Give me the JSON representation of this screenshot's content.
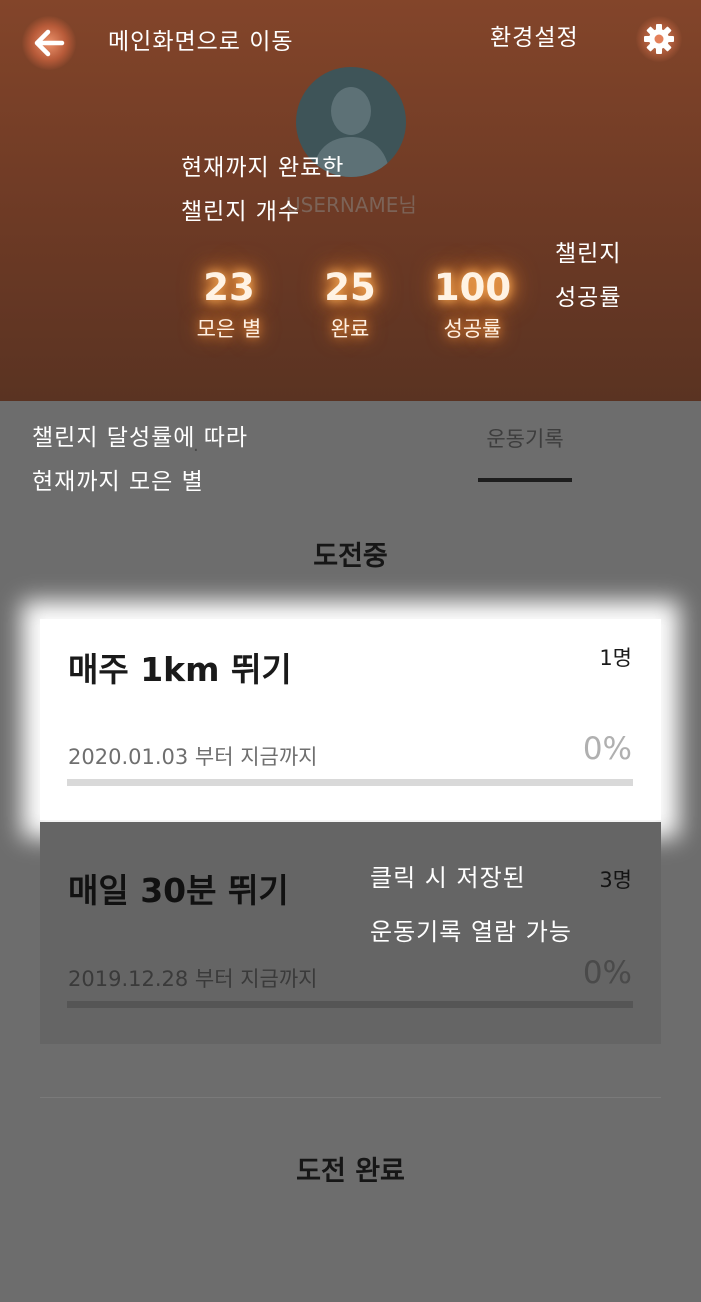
{
  "header": {
    "back_hint": "메인화면으로 이동",
    "settings_hint": "환경설정",
    "username": "USERNAME님",
    "completed_hint_line1": "현재까지 완료한",
    "completed_hint_line2": "챌린지 개수",
    "success_rate_hint_line1": "챌린지",
    "success_rate_hint_line2": "성공률"
  },
  "stats": [
    {
      "value": "23",
      "label": "모은 별"
    },
    {
      "value": "25",
      "label": "완료"
    },
    {
      "value": "100",
      "label": "성공률"
    }
  ],
  "tabs": {
    "stars_hint_line1": "챌린지 달성률에 따라",
    "stars_hint_line2": "현재까지 모은 별",
    "stars_tab_fragment": "·",
    "record_label": "운동기록"
  },
  "sections": {
    "ongoing_title": "도전중",
    "completed_title": "도전 완료"
  },
  "challenges": [
    {
      "title": "매주 1km 뛰기",
      "participants": "1명",
      "date": "2020.01.03 부터 지금까지",
      "percent": "0%",
      "progress": 0
    },
    {
      "title": "매일 30분 뛰기",
      "participants": "3명",
      "date": "2019.12.28 부터 지금까지",
      "percent": "0%",
      "progress": 0
    }
  ],
  "record_hint_line1": "클릭 시 저장된",
  "record_hint_line2": "운동기록 열람 가능",
  "colors": {
    "header_top": "#83452a",
    "header_bottom": "#5a3322",
    "overlay": "#6d6d6d",
    "glow": "#ff9a3c"
  },
  "icons": {
    "back": "arrow-left-icon",
    "settings": "gear-icon",
    "avatar": "user-silhouette-icon"
  }
}
